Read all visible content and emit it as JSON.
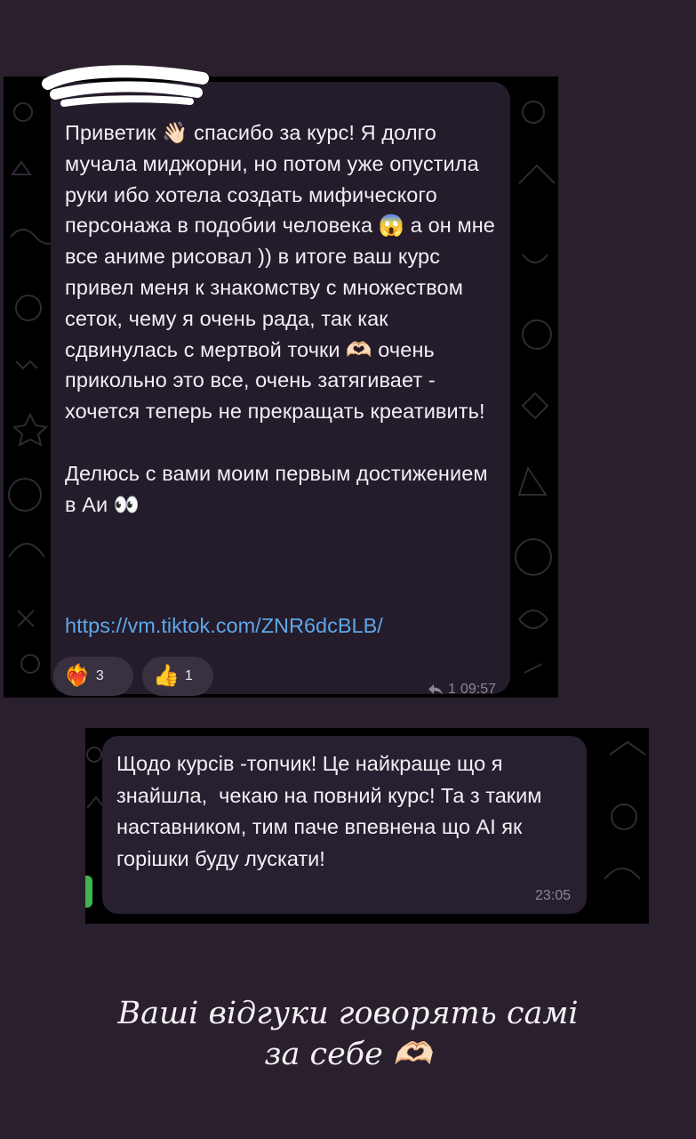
{
  "chat_message_1": {
    "text": "Приветик 👋🏻 спасибо за курс! Я долго мучала миджорни, но потом уже опустила руки ибо хотела создать мифического персонажа в подобии человека 😱 а он мне все аниме рисовал )) в итоге ваш курс привел меня к знакомству с множеством сеток, чему я очень рада, так как сдвинулась с мертвой точки 🫶🏻 очень прикольно это все, очень затягивает - хочется теперь не прекращать креативить!\n\nДелюсь с вами моим первым достижением в Аи 👀",
    "link": "https://vm.tiktok.com/ZNR6dcBLB/",
    "reactions": [
      {
        "emoji": "❤️‍🔥",
        "count": "3"
      },
      {
        "emoji": "👍",
        "count": "1"
      }
    ],
    "replies_icon": "reply-arrow-icon",
    "replies_count": "1",
    "time": "09:57"
  },
  "chat_message_2": {
    "text": "Щодо курсів -топчик! Це найкраще що я знайшла,  чекаю на повний курс! Та з таким наставником, тим паче впевнена що AI як горішки буду лускати!",
    "time": "23:05"
  },
  "caption": {
    "line1": "Ваші відгуки говорять самі",
    "line2": "за себе 🫶🏻"
  },
  "colors": {
    "page_background": "#2a1f2c",
    "bubble": "#241b2b",
    "link": "#5fa8e8",
    "accent_green": "#3fb34f"
  }
}
